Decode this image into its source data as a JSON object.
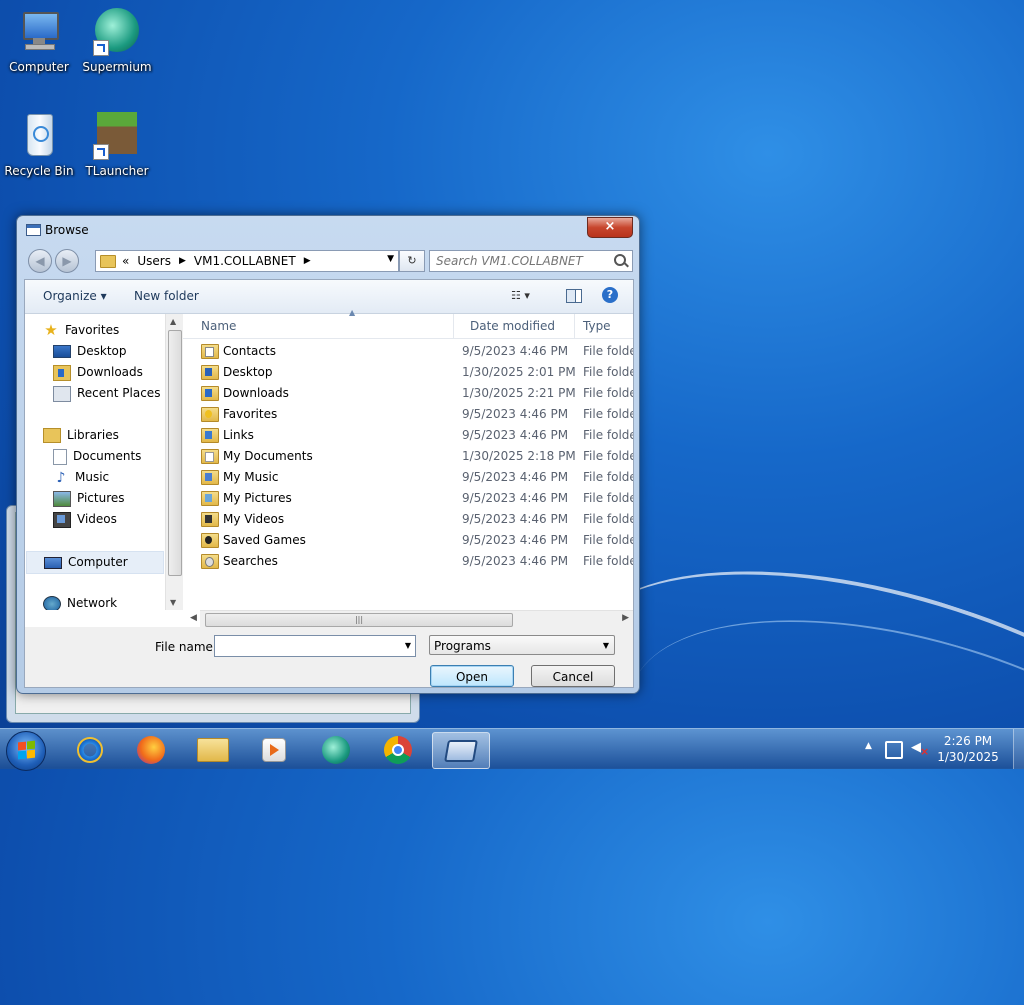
{
  "desktop": {
    "icons": [
      {
        "label": "Computer",
        "icon": "computer-icon"
      },
      {
        "label": "Supermium",
        "icon": "supermium-icon"
      },
      {
        "label": "Recycle Bin",
        "icon": "recycle-bin-icon"
      },
      {
        "label": "TLauncher",
        "icon": "tlauncher-icon"
      }
    ]
  },
  "dialog": {
    "title": "Browse",
    "close_label": "×",
    "breadcrumb": [
      "«",
      "Users",
      "VM1.COLLABNET"
    ],
    "search_placeholder": "Search VM1.COLLABNET",
    "toolbar": {
      "organize": "Organize ▾",
      "new_folder": "New folder",
      "view_icon": "☷ ▾",
      "help": "?"
    },
    "nav_pane": {
      "items": [
        {
          "label": "Favorites",
          "icon": "star-icon"
        },
        {
          "label": "Desktop",
          "icon": "desktop-icon"
        },
        {
          "label": "Downloads",
          "icon": "downloads-icon"
        },
        {
          "label": "Recent Places",
          "icon": "recent-places-icon"
        },
        {
          "label": "Libraries",
          "icon": "libraries-icon"
        },
        {
          "label": "Documents",
          "icon": "documents-icon"
        },
        {
          "label": "Music",
          "icon": "music-icon"
        },
        {
          "label": "Pictures",
          "icon": "pictures-icon"
        },
        {
          "label": "Videos",
          "icon": "videos-icon"
        },
        {
          "label": "Computer",
          "icon": "computer-icon",
          "selected": true
        },
        {
          "label": "Network",
          "icon": "network-icon"
        }
      ]
    },
    "columns": {
      "name": "Name",
      "date": "Date modified",
      "type": "Type"
    },
    "files": [
      {
        "name": "Contacts",
        "date": "9/5/2023 4:46 PM",
        "type": "File folder"
      },
      {
        "name": "Desktop",
        "date": "1/30/2025 2:01 PM",
        "type": "File folder"
      },
      {
        "name": "Downloads",
        "date": "1/30/2025 2:21 PM",
        "type": "File folder"
      },
      {
        "name": "Favorites",
        "date": "9/5/2023 4:46 PM",
        "type": "File folder"
      },
      {
        "name": "Links",
        "date": "9/5/2023 4:46 PM",
        "type": "File folder"
      },
      {
        "name": "My Documents",
        "date": "1/30/2025 2:18 PM",
        "type": "File folder"
      },
      {
        "name": "My Music",
        "date": "9/5/2023 4:46 PM",
        "type": "File folder"
      },
      {
        "name": "My Pictures",
        "date": "9/5/2023 4:46 PM",
        "type": "File folder"
      },
      {
        "name": "My Videos",
        "date": "9/5/2023 4:46 PM",
        "type": "File folder"
      },
      {
        "name": "Saved Games",
        "date": "9/5/2023 4:46 PM",
        "type": "File folder"
      },
      {
        "name": "Searches",
        "date": "9/5/2023 4:46 PM",
        "type": "File folder"
      }
    ],
    "file_name_label": "File name:",
    "file_name_value": "",
    "file_type": "Programs",
    "open_label": "Open",
    "cancel_label": "Cancel"
  },
  "taskbar": {
    "apps": [
      "internet-explorer-icon",
      "firefox-icon",
      "windows-explorer-icon",
      "media-player-icon",
      "supermium-icon",
      "chrome-icon",
      "browse-dialog-icon"
    ],
    "clock_time": "2:26 PM",
    "clock_date": "1/30/2025"
  }
}
